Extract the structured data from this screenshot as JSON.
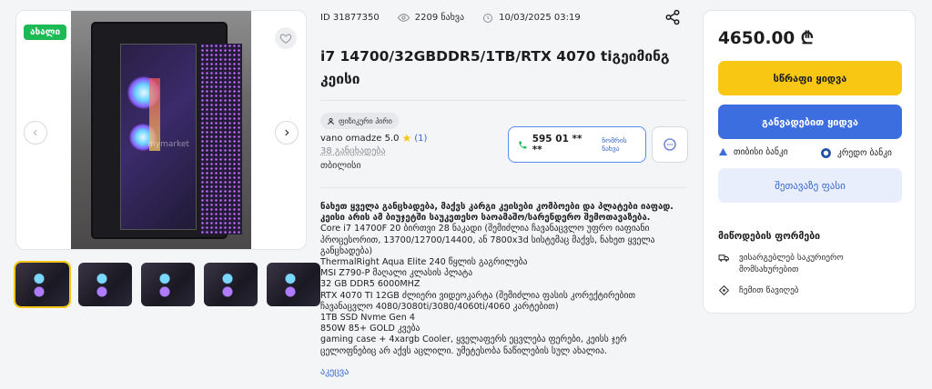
{
  "gallery": {
    "badge": "ახალი",
    "watermark": "mymarket",
    "thumbnail_count": 5
  },
  "meta": {
    "id": "ID 31877350",
    "views": "2209 ნახვა",
    "date": "10/03/2025 03:19"
  },
  "product": {
    "title": "i7 14700/32GBDDR5/1TB/RTX 4070 tiგეიმინგ კეისი"
  },
  "seller": {
    "type": "ფიზიკური პირი",
    "name": "vano omadze 5.0",
    "rating_count": "(1)",
    "ads": "38 განცხადება",
    "city": "თბილისი"
  },
  "phone": {
    "number": "595 01 ** **",
    "show": "ნომრის ნახვა"
  },
  "description": {
    "lines": [
      {
        "text": "ნახეთ ყველა განცხადება, მაქვს კარგი კეისები კომბოები და პლატები იაფად.",
        "bold": true
      },
      {
        "text": "კეისი არის ამ ბიუჯეტში საუკეთესო საოამაშო/სარენდერო შემოთავაზება.",
        "bold": true
      },
      {
        "text": "Core i7 14700F 20 ბირთვი 28 ნაკადი (შემიძლია ჩავანაცვლო უფრო იაფიანი",
        "bold": false
      },
      {
        "text": "პროცესორით, 13700/12700/14400, ან 7800x3d სისტემაც მაქვს, ნახეთ ყველა",
        "bold": false
      },
      {
        "text": "განცხადება)",
        "bold": false
      },
      {
        "text": "ThermalRight Aqua Elite 240 წყლის გაგრილება",
        "bold": false
      },
      {
        "text": "MSI Z790-P მაღალი კლასის პლატა",
        "bold": false
      },
      {
        "text": "32 GB DDR5 6000MHZ",
        "bold": false
      },
      {
        "text": "RTX 4070 TI 12GB ძლიერი ვიდეოკარტა (შემიძლია ფასის კორექტირებით",
        "bold": false
      },
      {
        "text": "ჩავანაცვლო 4080/3080ti/3080/4060ti/4060 კარტებით)",
        "bold": false
      },
      {
        "text": "1TB SSD Nvme Gen 4",
        "bold": false
      },
      {
        "text": "850W 85+ GOLD კვება",
        "bold": false
      },
      {
        "text": "gaming case + 4xargb Cooler, ყველაფერს ეცვლება ფერები, კეისს ჯერ",
        "bold": false
      },
      {
        "text": "ცელოფნებიც არ აქვს აცლილი. უმეტესობა ნაწილების სულ ახალია.",
        "bold": false
      }
    ],
    "more": "აკეცვა"
  },
  "purchase": {
    "price": "4650.00 ₾",
    "buy_now": "სწრაფი ყიდვა",
    "installment": "განვადებით ყიდვა",
    "bank_tbc": "თიბისი ბანკი",
    "bank_credo": "კრედო ბანკი",
    "offer": "შეთავაზე ფასი",
    "delivery_title": "მიწოდების ფორმები",
    "delivery_courier": "ვისარგებლებ საკურიერო მომსახურებით",
    "delivery_pickup": "ჩემით წავიღებ"
  },
  "colors": {
    "accent_yellow": "#f7c714",
    "accent_blue": "#3d6ee0",
    "badge_green": "#1db954",
    "link_blue": "#3366cc"
  }
}
